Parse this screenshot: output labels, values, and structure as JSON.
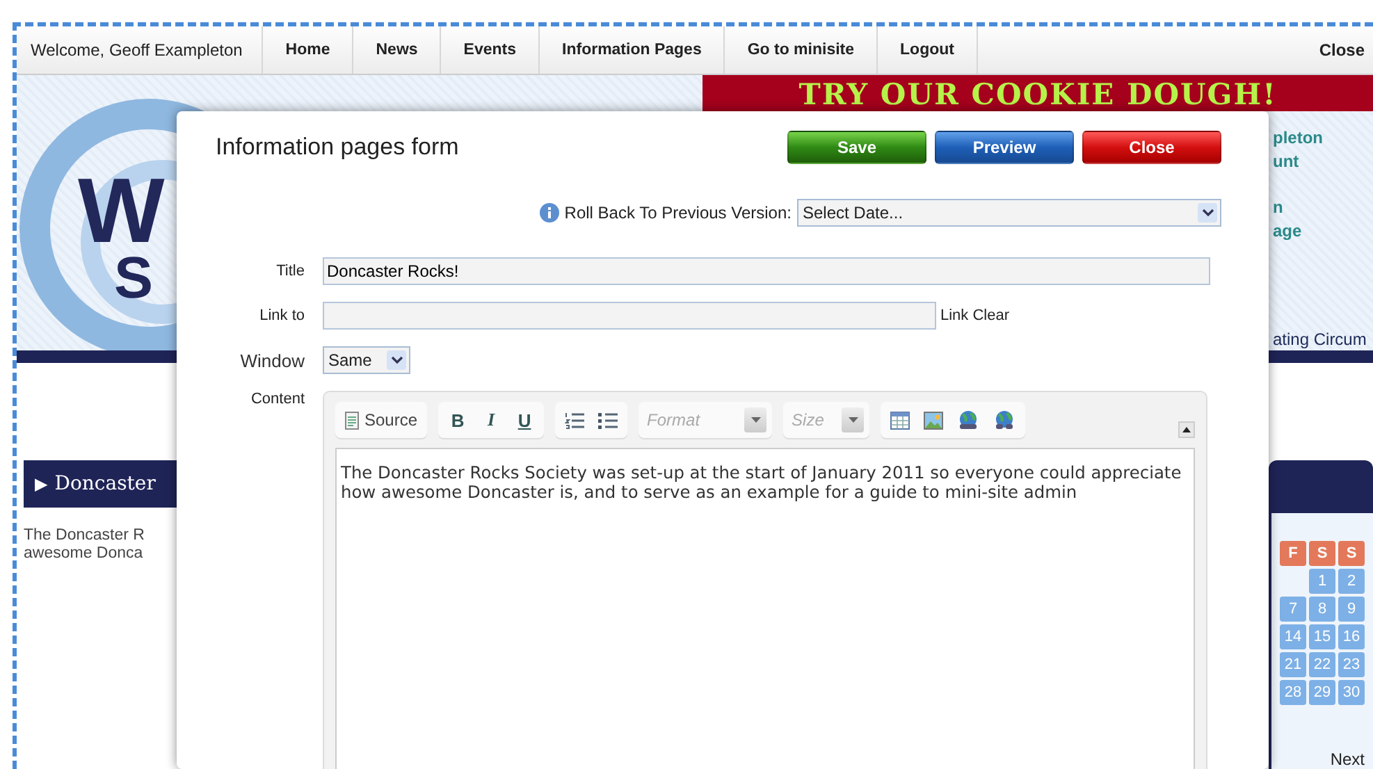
{
  "nav": {
    "welcome": "Welcome, Geoff Exampleton",
    "items": [
      "Home",
      "News",
      "Events",
      "Information Pages",
      "Go to minisite",
      "Logout"
    ],
    "close": "Close"
  },
  "background": {
    "banner": "TRY OUR COOKIE DOUGH!",
    "logo_text": [
      "W",
      "S"
    ],
    "side_links": [
      "pleton",
      "unt",
      "n",
      "age"
    ],
    "ticker": "ating Circum",
    "section_marker": "▶",
    "section_heading": "Doncaster",
    "excerpt": [
      "The Doncaster R",
      "awesome Donca"
    ],
    "calendar": {
      "headers": [
        "F",
        "S",
        "S"
      ],
      "weeks": [
        [
          "1",
          "2"
        ],
        [
          "7",
          "8",
          "9"
        ],
        [
          "14",
          "15",
          "16"
        ],
        [
          "21",
          "22",
          "23"
        ],
        [
          "28",
          "29",
          "30"
        ]
      ],
      "next": "Next"
    }
  },
  "modal": {
    "title": "Information pages form",
    "buttons": [
      {
        "label": "Save",
        "kind": "save"
      },
      {
        "label": "Preview",
        "kind": "preview"
      },
      {
        "label": "Close",
        "kind": "close"
      }
    ],
    "rollback": {
      "label": "Roll Back To Previous Version:",
      "value": "Select Date..."
    },
    "title_field": {
      "label": "Title",
      "value": "Doncaster Rocks!"
    },
    "link_field": {
      "label": "Link to",
      "action": "Link Clear"
    },
    "window_field": {
      "label": "Window",
      "value": "Same"
    },
    "content": {
      "label": "Content",
      "source": "Source",
      "styles": [
        "B",
        "I",
        "U"
      ],
      "format_placeholder": "Format",
      "size_placeholder": "Size",
      "text": "The Doncaster Rocks Society was set-up at the start of January 2011 so everyone could appreciate how awesome Doncaster is, and to serve as an example for a guide to mini-site admin"
    }
  }
}
